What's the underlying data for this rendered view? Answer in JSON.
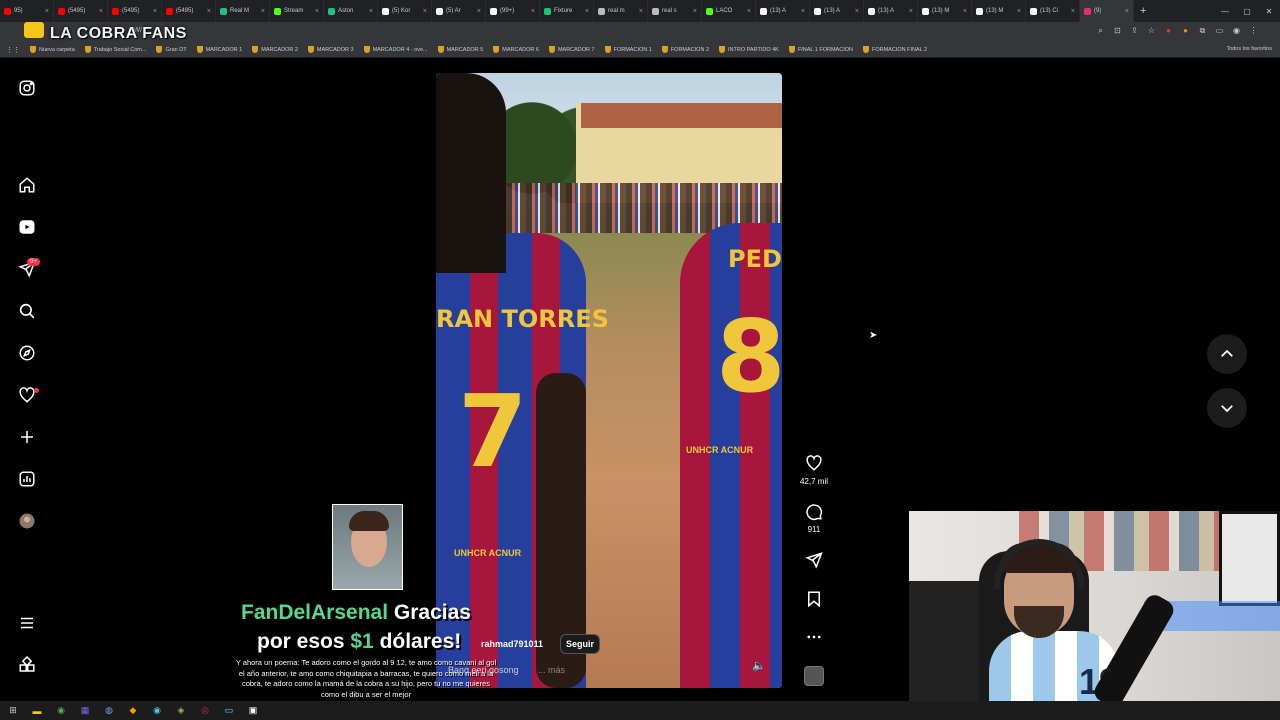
{
  "browser": {
    "tabs": [
      {
        "label": "95)",
        "color": "#ff0000",
        "active": false
      },
      {
        "label": "(5495)",
        "color": "#ff0000",
        "active": false
      },
      {
        "label": "(5495)",
        "color": "#ff0000",
        "active": false
      },
      {
        "label": "(5495)",
        "color": "#ff0000",
        "active": false
      },
      {
        "label": "Real M",
        "color": "#19c37d",
        "active": false
      },
      {
        "label": "Stream",
        "color": "#53fc18",
        "active": false
      },
      {
        "label": "Aston",
        "color": "#19c37d",
        "active": false
      },
      {
        "label": "(5) Kor",
        "color": "#ffffff",
        "active": false
      },
      {
        "label": "(5) Ar",
        "color": "#ffffff",
        "active": false
      },
      {
        "label": "(99+)",
        "color": "#ffffff",
        "active": false
      },
      {
        "label": "Fixture",
        "color": "#19c37d",
        "active": false
      },
      {
        "label": "real m",
        "color": "#bbbbbb",
        "active": false
      },
      {
        "label": "real s",
        "color": "#bbbbbb",
        "active": false
      },
      {
        "label": "LACO",
        "color": "#53fc18",
        "active": false
      },
      {
        "label": "(13) A",
        "color": "#ffffff",
        "active": false
      },
      {
        "label": "(13) A",
        "color": "#ffffff",
        "active": false
      },
      {
        "label": "(13) A",
        "color": "#ffffff",
        "active": false
      },
      {
        "label": "(13) M",
        "color": "#ffffff",
        "active": false
      },
      {
        "label": "(13) M",
        "color": "#ffffff",
        "active": false
      },
      {
        "label": "(13) Ci",
        "color": "#ffffff",
        "active": false
      },
      {
        "label": "(9)",
        "color": "#e1306c",
        "active": true
      }
    ],
    "new_tab": "+",
    "url": "yW/",
    "overlay_title": "LA COBRA FANS",
    "bookmarks": [
      "Nueva carpeta",
      "Trabajo Social Com...",
      "Gran DT",
      "MARCADOR 1",
      "MARCADOR 2",
      "MARCADOR 3",
      "MARCADOR 4 - ove...",
      "MARCADOR 5",
      "MARCADOR 6",
      "MARCADOR 7",
      "FORMACION 1",
      "FORMACION 2",
      "INTRO PARTIDO 4K",
      "FINAL 1 FORMACION",
      "FORMACION FINAL 2"
    ],
    "bookmarks_right": "Todos los favoritos"
  },
  "sidebar": {
    "icons": [
      "instagram-icon",
      "home-icon",
      "reels-icon",
      "messages-icon",
      "search-icon",
      "explore-icon",
      "notifications-icon",
      "create-icon",
      "dashboard-icon",
      "profile-avatar",
      "menu-icon",
      "more-apps-icon"
    ],
    "messages_badge": "9+"
  },
  "reel": {
    "jersey_name_1": "RAN TORRES",
    "jersey_number_1": "7",
    "jersey_name_2": "PED",
    "jersey_number_2": "8",
    "sponsor_1": "UNHCR ACNUR",
    "sponsor_2": "UNHCR ACNUR",
    "likes": "42,7 mil",
    "comments": "911",
    "author": "rahmad791011",
    "follow_label": "Seguir",
    "audio": "Bang eeri gosong",
    "more_label": "... más"
  },
  "donation": {
    "name": "FanDelArsenal",
    "line1_rest": " Gracias",
    "line2_prefix": "por esos ",
    "amount": "$1",
    "line2_suffix": " dólares!",
    "message": "Y ahora un poema: Te adoro como el gordo al 9 12, te amo como cavani al gol el año anterior, te amo como chiquitapia a barracas, te quiero como meli a la cobra, te adoro como la mamá de la cobra a su hijo, pero tu no me quieres como el dibu a ser el mejor"
  }
}
